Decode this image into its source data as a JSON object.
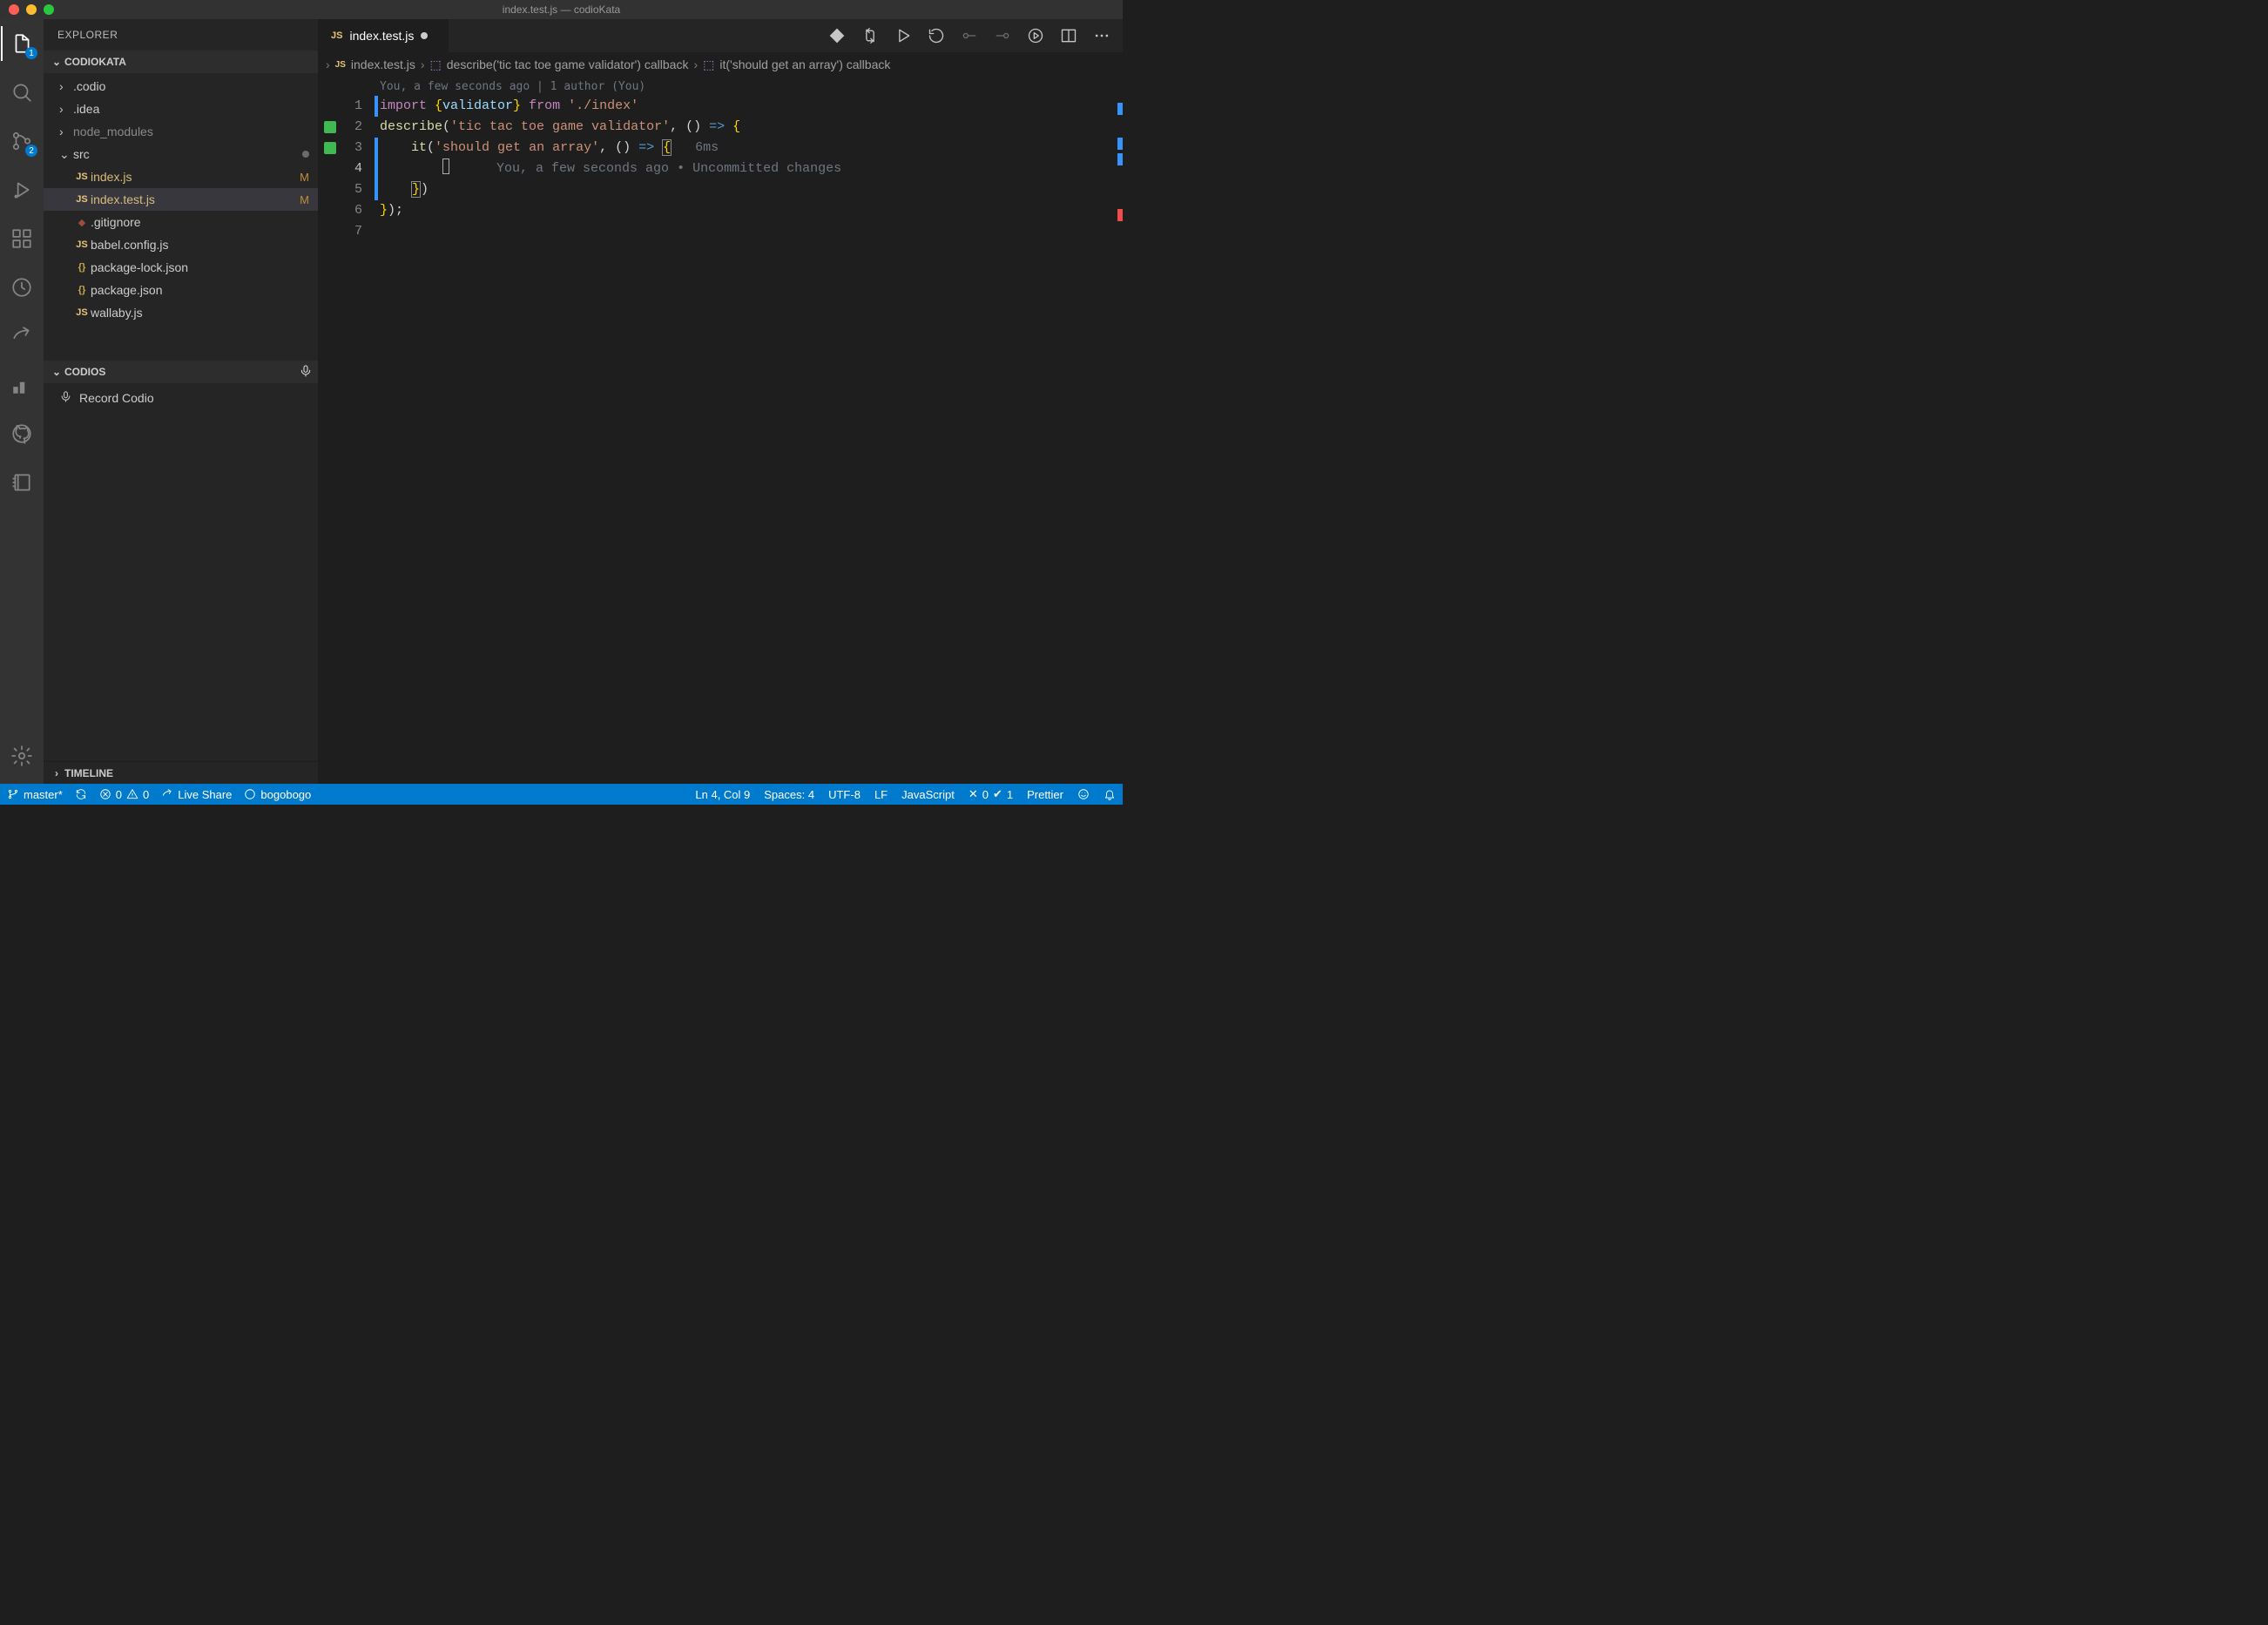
{
  "titlebar": {
    "title": "index.test.js — codioKata"
  },
  "activitybar": {
    "explorer_badge": "1",
    "scm_badge": "2"
  },
  "sidebar": {
    "title": "EXPLORER",
    "project": "CODIOKATA",
    "tree": {
      "codio": ".codio",
      "idea": ".idea",
      "node_modules": "node_modules",
      "src": "src",
      "indexjs": "index.js",
      "indexjs_decor": "M",
      "indextest": "index.test.js",
      "indextest_decor": "M",
      "gitignore": ".gitignore",
      "babel": "babel.config.js",
      "pkglock": "package-lock.json",
      "pkg": "package.json",
      "wallaby": "wallaby.js"
    },
    "codios_header": "CODIOS",
    "record_codio": "Record Codio",
    "timeline": "TIMELINE"
  },
  "tabs": {
    "active_label": "index.test.js"
  },
  "breadcrumb": {
    "file": "index.test.js",
    "seg2": "describe('tic tac toe game validator') callback",
    "seg3": "it('should get an array') callback"
  },
  "authorship": {
    "line": "You, a few seconds ago | 1 author (You)"
  },
  "editor": {
    "l1_import": "import",
    "l1_brace_open": " {",
    "l1_validator": "validator",
    "l1_brace_close": "}",
    "l1_from": " from ",
    "l1_path": "'./index'",
    "l2_describe": "describe",
    "l2_str": "'tic tac toe game validator'",
    "l3_it": "it",
    "l3_str": "'should get an array'",
    "l3_timing": "6ms",
    "l4_ghost": "You, a few seconds ago • Uncommitted changes",
    "linenos": [
      "1",
      "2",
      "3",
      "4",
      "5",
      "6",
      "7"
    ]
  },
  "statusbar": {
    "branch": "master*",
    "errors": "0",
    "warnings": "0",
    "liveshare": "Live Share",
    "user": "bogobogo",
    "position": "Ln 4, Col 9",
    "spaces": "Spaces: 4",
    "encoding": "UTF-8",
    "eol": "LF",
    "lang": "JavaScript",
    "tests_fail": "0",
    "tests_pass": "1",
    "prettier": "Prettier"
  }
}
